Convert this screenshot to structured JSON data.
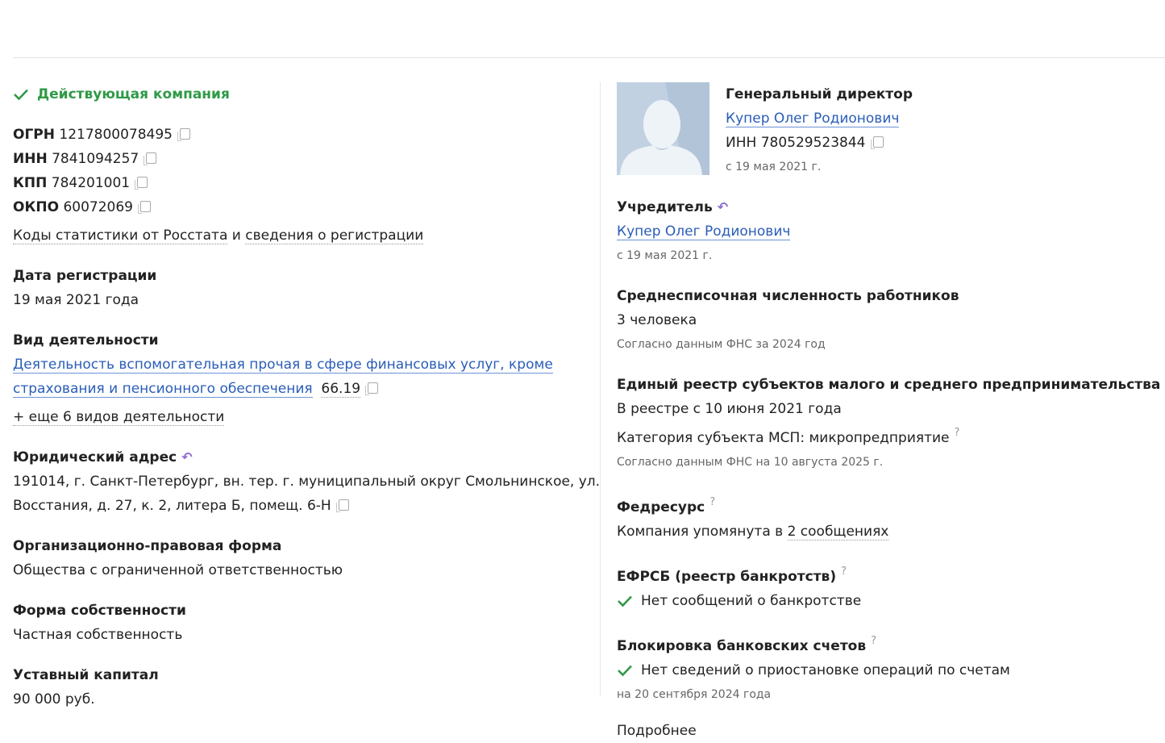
{
  "status": "Действующая компания",
  "codes": [
    {
      "label": "ОГРН",
      "value": "1217800078495"
    },
    {
      "label": "ИНН",
      "value": "7841094257"
    },
    {
      "label": "КПП",
      "value": "784201001"
    },
    {
      "label": "ОКПО",
      "value": "60072069"
    }
  ],
  "stats_link": {
    "part1": "Коды статистики от Росстата",
    "conj": "и",
    "part2": "сведения о регистрации"
  },
  "registration": {
    "label": "Дата регистрации",
    "value": "19 мая 2021 года"
  },
  "activity": {
    "label": "Вид деятельности",
    "line1": "Деятельность вспомогательная прочая в сфере финансовых услуг, кроме",
    "line2": "страхования и пенсионного обеспечения",
    "code": "66.19",
    "more": "+ еще 6 видов деятельности"
  },
  "address": {
    "label": "Юридический адрес",
    "line1": "191014, г. Санкт-Петербург, вн. тер. г. муниципальный округ Смольнинское, ул.",
    "line2": "Восстания, д. 27, к. 2, литера Б, помещ. 6-Н"
  },
  "org_form": {
    "label": "Организационно-правовая форма",
    "value": "Общества с ограниченной ответственностью"
  },
  "ownership": {
    "label": "Форма собственности",
    "value": "Частная собственность"
  },
  "capital": {
    "label": "Уставный капитал",
    "value": "90 000 руб."
  },
  "director": {
    "title": "Генеральный директор",
    "name": "Купер Олег Родионович",
    "inn_label": "ИНН",
    "inn": "780529523844",
    "since": "с 19 мая 2021 г."
  },
  "founder": {
    "label": "Учредитель",
    "name": "Купер Олег Родионович",
    "since": "с 19 мая 2021 г."
  },
  "employees": {
    "label": "Среднесписочная численность работников",
    "value": "3 человека",
    "source": "Согласно данным ФНС за 2024 год"
  },
  "msp": {
    "label": "Единый реестр субъектов малого и среднего предпринимательства",
    "line1": "В реестре с 10 июня 2021 года",
    "line2": "Категория субъекта МСП: микропредприятие",
    "source": "Согласно данным ФНС на 10 августа 2025 г."
  },
  "fedresurs": {
    "label": "Федресурс",
    "text_prefix": "Компания упомянута в",
    "link": "2 сообщениях"
  },
  "efrsb": {
    "label": "ЕФРСБ (реестр банкротств)",
    "value": "Нет сообщений о банкротстве"
  },
  "bank_block": {
    "label": "Блокировка банковских счетов",
    "value": "Нет сведений о приостановке операций по счетам",
    "date": "на 20 сентября 2024 года"
  },
  "next_label": "Подробнее",
  "icons": {
    "question": "?",
    "history": "↶"
  },
  "colors": {
    "green": "#2f9a47",
    "link": "#2a5db8",
    "purple": "#8e6cd1"
  }
}
